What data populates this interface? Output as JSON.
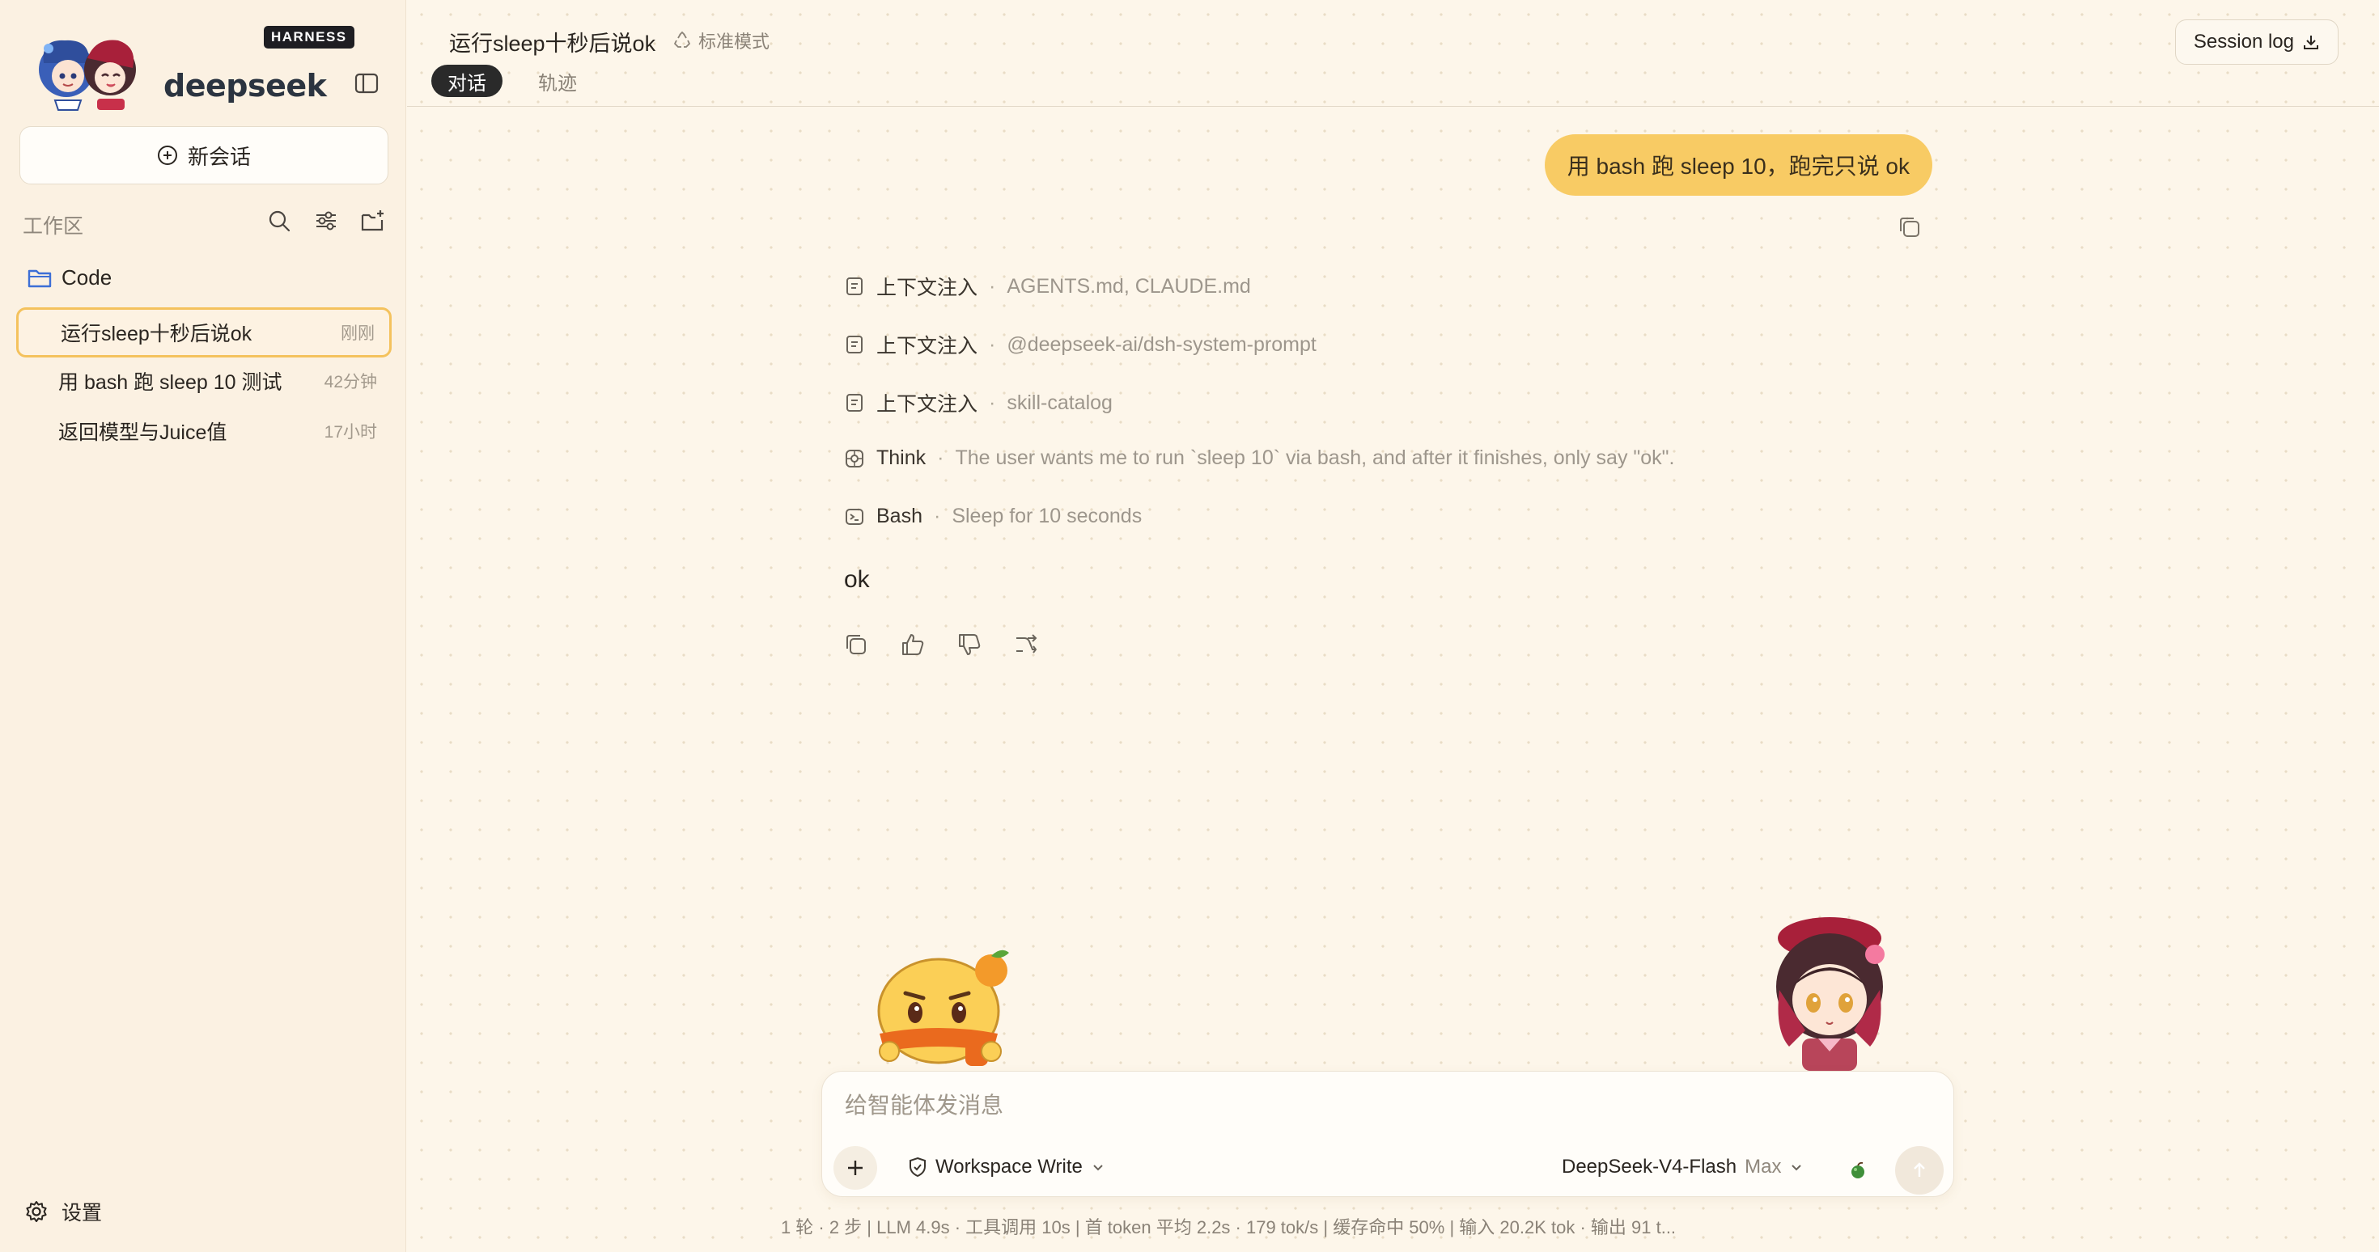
{
  "brand": {
    "name": "deepseek",
    "badge": "HARNESS"
  },
  "sidebar": {
    "new_chat_label": "新会话",
    "workspace_label": "工作区",
    "folder_name": "Code",
    "chats": [
      {
        "title": "运行sleep十秒后说ok",
        "time": "刚刚",
        "active": true
      },
      {
        "title": "用 bash 跑 sleep 10 测试",
        "time": "42分钟",
        "active": false
      },
      {
        "title": "返回模型与Juice值",
        "time": "17小时",
        "active": false
      }
    ],
    "settings_label": "设置"
  },
  "header": {
    "title": "运行sleep十秒后说ok",
    "mode": "标准模式",
    "tabs": [
      "对话",
      "轨迹"
    ],
    "session_log_label": "Session log"
  },
  "conversation": {
    "user_message": "用 bash 跑 sleep 10，跑完只说 ok",
    "steps": [
      {
        "icon": "document-icon",
        "label": "上下文注入",
        "detail": "AGENTS.md, CLAUDE.md"
      },
      {
        "icon": "document-icon",
        "label": "上下文注入",
        "detail": "@deepseek-ai/dsh-system-prompt"
      },
      {
        "icon": "document-icon",
        "label": "上下文注入",
        "detail": "skill-catalog"
      },
      {
        "icon": "think-icon",
        "label": "Think",
        "detail": "The user wants me to run `sleep 10` via bash, and after it finishes, only say \"ok\"."
      },
      {
        "icon": "terminal-icon",
        "label": "Bash",
        "detail": "Sleep for 10 seconds"
      }
    ],
    "assistant_reply": "ok"
  },
  "composer": {
    "placeholder": "给智能体发消息",
    "workspace_mode": "Workspace Write",
    "model": "DeepSeek-V4-Flash",
    "effort": "Max"
  },
  "statusbar": {
    "text": "1 轮 · 2 步   |   LLM 4.9s · 工具调用 10s   |   首 token 平均 2.2s · 179 tok/s   |   缓存命中 50%   |   输入 20.2K tok · 输出 91 t..."
  },
  "colors": {
    "accent": "#f8cb64",
    "active_border": "#f4c25d",
    "background": "#fdf6ea",
    "status_green": "#3f8f3a"
  }
}
